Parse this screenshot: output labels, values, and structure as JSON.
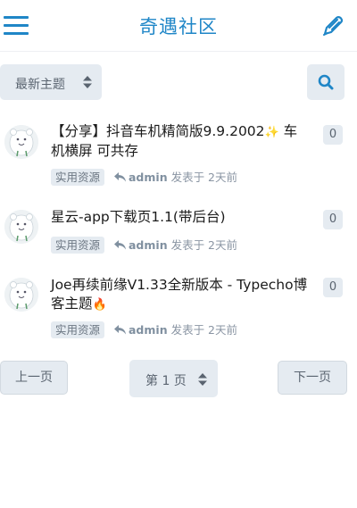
{
  "header": {
    "title": "奇遇社区",
    "menu_icon": "hamburger-menu-icon",
    "compose_icon": "pen-icon",
    "accent_color": "#1f86c7"
  },
  "toolbar": {
    "sort_selected": "最新主题",
    "search_icon": "search-icon"
  },
  "topics": [
    {
      "title": "【分享】抖音车机精简版9.9.2002",
      "emoji": "✨",
      "title_end": "车机横屏 可共存",
      "replies": "0",
      "tag": "实用资源",
      "author": "admin",
      "posted": "发表于 2天前"
    },
    {
      "title": "星云-app下载页1.1(带后台)",
      "emoji": "",
      "title_end": "",
      "replies": "0",
      "tag": "实用资源",
      "author": "admin",
      "posted": "发表于 2天前"
    },
    {
      "title": "Joe再续前缘V1.33全新版本 - Typecho博客主题",
      "emoji": "🔥",
      "title_end": "",
      "replies": "0",
      "tag": "实用资源",
      "author": "admin",
      "posted": "发表于 2天前"
    }
  ],
  "pagination": {
    "prev_label": "上一页",
    "page_selected": "第 1 页",
    "next_label": "下一页"
  }
}
